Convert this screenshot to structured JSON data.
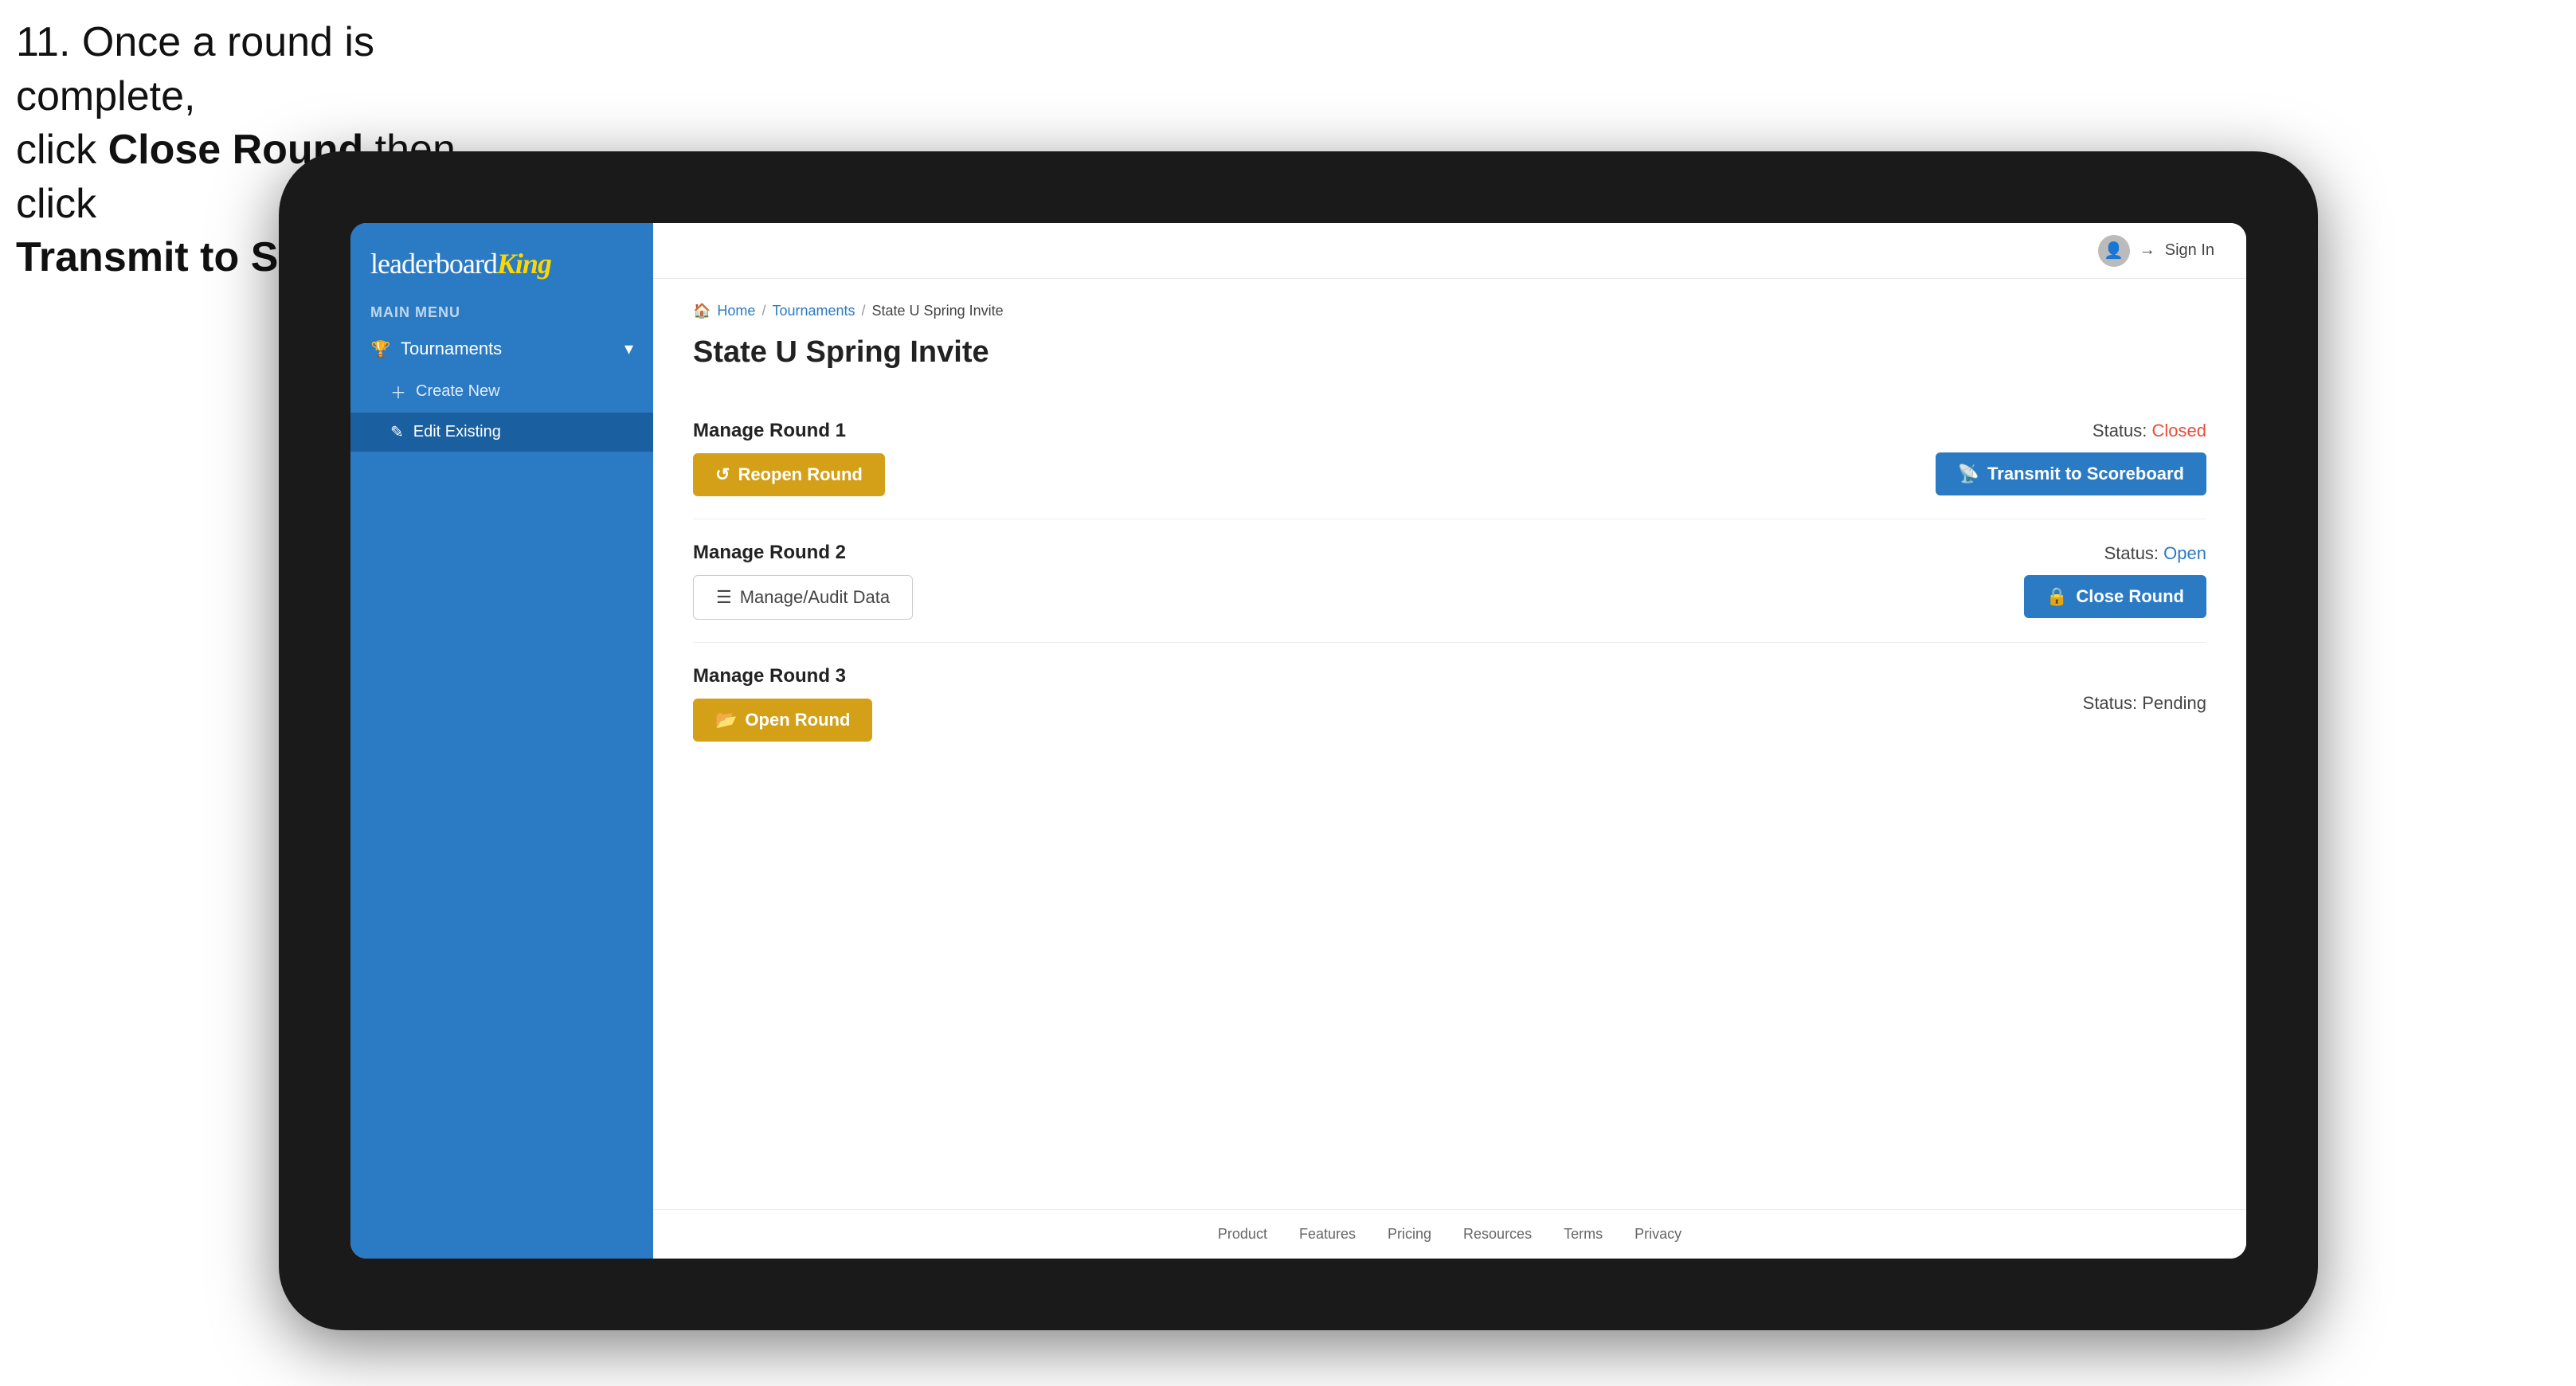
{
  "instruction": {
    "line1": "11. Once a round is complete,",
    "line2": "click ",
    "bold1": "Close Round",
    "line3": " then click",
    "bold2": "Transmit to Scoreboard."
  },
  "app": {
    "logo": {
      "leaderboard": "leaderboard",
      "king": "King"
    },
    "header": {
      "sign_in": "Sign In"
    },
    "sidebar": {
      "main_menu_label": "MAIN MENU",
      "nav_items": [
        {
          "label": "Tournaments",
          "icon": "trophy",
          "expanded": true
        }
      ],
      "sub_items": [
        {
          "label": "Create New",
          "icon": "plus"
        },
        {
          "label": "Edit Existing",
          "icon": "edit",
          "active": true
        }
      ]
    },
    "breadcrumb": {
      "home": "Home",
      "sep1": "/",
      "tournaments": "Tournaments",
      "sep2": "/",
      "current": "State U Spring Invite"
    },
    "page_title": "State U Spring Invite",
    "rounds": [
      {
        "title": "Manage Round 1",
        "status_label": "Status:",
        "status_value": "Closed",
        "status_type": "closed",
        "buttons": [
          {
            "label": "Reopen Round",
            "type": "gold",
            "icon": "reopen"
          },
          {
            "label": "Transmit to Scoreboard",
            "type": "blue",
            "icon": "transmit"
          }
        ]
      },
      {
        "title": "Manage Round 2",
        "status_label": "Status:",
        "status_value": "Open",
        "status_type": "open",
        "buttons": [
          {
            "label": "Manage/Audit Data",
            "type": "audit",
            "icon": "audit"
          },
          {
            "label": "Close Round",
            "type": "blue",
            "icon": "close"
          }
        ]
      },
      {
        "title": "Manage Round 3",
        "status_label": "Status:",
        "status_value": "Pending",
        "status_type": "pending",
        "buttons": [
          {
            "label": "Open Round",
            "type": "gold",
            "icon": "open"
          }
        ]
      }
    ],
    "footer": {
      "links": [
        "Product",
        "Features",
        "Pricing",
        "Resources",
        "Terms",
        "Privacy"
      ]
    }
  }
}
